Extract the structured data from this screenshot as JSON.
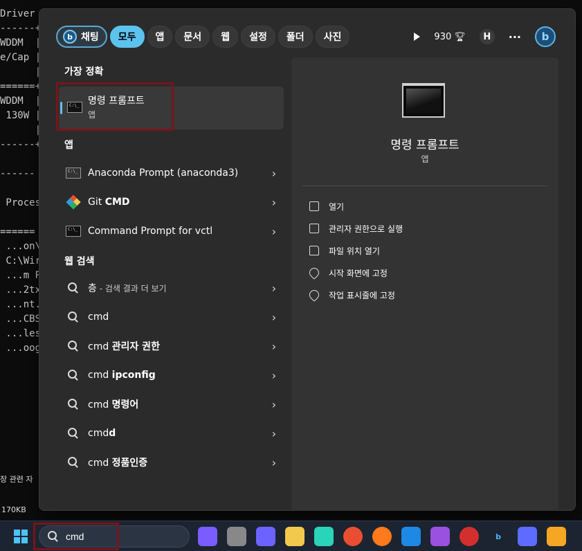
{
  "background": {
    "lines": [
      "Driver  +==========================================+",
      "------+",
      "WDDM  |",
      "e/Cap |",
      "      |",
      "======+",
      "WDDM  |",
      " 130W |",
      "      |",
      "------+",
      "",
      "------",
      "",
      " Proces",
      "",
      "======",
      " ...on\\",
      " C:\\Wir",
      " ...m P",
      " ...2tx",
      " ...nt.",
      " ...CBS",
      " ...les",
      " ...oog"
    ],
    "bottom_text_1": "장 관련 자",
    "bottom_text_2": "170KB"
  },
  "filters": {
    "chat": "채팅",
    "all": "모두",
    "app": "앱",
    "docs": "문서",
    "web": "웹",
    "settings": "설정",
    "folders": "폴더",
    "photos": "사진"
  },
  "topbar": {
    "points": "930",
    "user_initial": "H",
    "more": "···"
  },
  "best_match": {
    "heading": "가장 정확",
    "title": "명령 프롬프트",
    "subtitle": "앱"
  },
  "apps": {
    "heading": "앱",
    "items": [
      {
        "pre": "Anaconda Prompt (anaconda3)",
        "bold": ""
      },
      {
        "pre": "Git ",
        "bold": "CMD"
      },
      {
        "pre": "Command Prompt for vctl",
        "bold": ""
      }
    ]
  },
  "web_search": {
    "heading": "웹 검색",
    "items": [
      {
        "pre": "층",
        "bold": "",
        "sub": " - 검색 결과 더 보기"
      },
      {
        "pre": "cmd",
        "bold": "",
        "sub": ""
      },
      {
        "pre": "cmd ",
        "bold": "관리자 권한",
        "sub": ""
      },
      {
        "pre": "cmd ",
        "bold": "ipconfig",
        "sub": ""
      },
      {
        "pre": "cmd ",
        "bold": "명령어",
        "sub": ""
      },
      {
        "pre": "cmd",
        "bold": "d",
        "sub": ""
      },
      {
        "pre": "cmd ",
        "bold": "정품인증",
        "sub": ""
      }
    ]
  },
  "preview": {
    "title": "명령 프롬프트",
    "subtitle": "앱",
    "actions": [
      "열기",
      "관리자 권한으로 실행",
      "파일 위치 열기",
      "시작 화면에 고정",
      "작업 표시줄에 고정"
    ]
  },
  "taskbar": {
    "search_value": "cmd",
    "apps": [
      "copilot-icon",
      "taskview-icon",
      "zoom-icon",
      "explorer-icon",
      "edge-icon",
      "chrome-icon",
      "firefox-icon",
      "vscode-icon",
      "app-icon",
      "opera-icon",
      "bing-icon",
      "camera-icon",
      "app2-icon"
    ]
  },
  "colors": {
    "accent": "#5cc3ef",
    "highlight": "#7a1419"
  }
}
